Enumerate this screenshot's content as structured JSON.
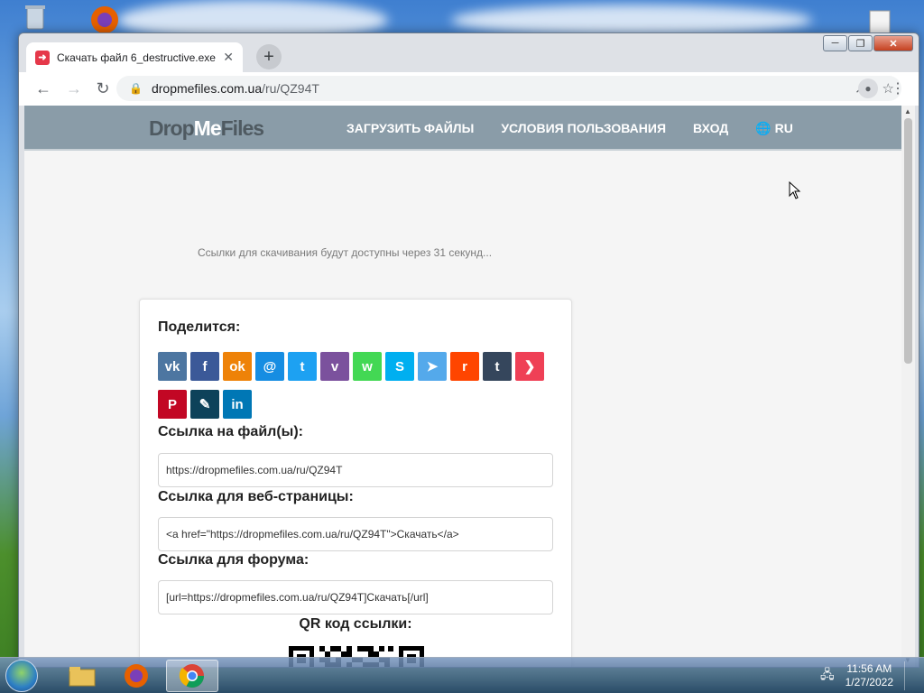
{
  "browser": {
    "tab_title": "Скачать файл 6_destructive.exe",
    "url_host": "dropmefiles.com.ua",
    "url_path": "/ru/QZ94T"
  },
  "site": {
    "logo_drop": "Drop",
    "logo_me": "Me",
    "logo_files": "Files",
    "nav": {
      "upload": "ЗАГРУЗИТЬ ФАЙЛЫ",
      "terms": "УСЛОВИЯ ПОЛЬЗОВАНИЯ",
      "login": "ВХОД",
      "lang": "RU"
    }
  },
  "page": {
    "countdown_text": "Ссылки для скачивания будут доступны через 31 секунд...",
    "share_heading": "Поделится:",
    "share_buttons": [
      {
        "name": "vk",
        "glyph": "vk",
        "color": "#4d76a1"
      },
      {
        "name": "facebook",
        "glyph": "f",
        "color": "#3b5998"
      },
      {
        "name": "odnoklassniki",
        "glyph": "ok",
        "color": "#ee8208"
      },
      {
        "name": "moimir",
        "glyph": "@",
        "color": "#168de2"
      },
      {
        "name": "twitter",
        "glyph": "t",
        "color": "#1da1f2"
      },
      {
        "name": "viber",
        "glyph": "v",
        "color": "#7b519d"
      },
      {
        "name": "whatsapp",
        "glyph": "w",
        "color": "#43d854"
      },
      {
        "name": "skype",
        "glyph": "S",
        "color": "#00aff0"
      },
      {
        "name": "telegram",
        "glyph": "➤",
        "color": "#54a9eb"
      },
      {
        "name": "reddit",
        "glyph": "r",
        "color": "#ff4500"
      },
      {
        "name": "tumblr",
        "glyph": "t",
        "color": "#35465c"
      },
      {
        "name": "pocket",
        "glyph": "❯",
        "color": "#ef4056"
      },
      {
        "name": "pinterest",
        "glyph": "P",
        "color": "#c20724"
      },
      {
        "name": "livejournal",
        "glyph": "✎",
        "color": "#0d425a"
      },
      {
        "name": "linkedin",
        "glyph": "in",
        "color": "#0077b5"
      }
    ],
    "file_link_label": "Ссылка на файл(ы):",
    "file_link_value": "https://dropmefiles.com.ua/ru/QZ94T",
    "web_link_label": "Ссылка для веб-страницы:",
    "web_link_value": "<a href=\"https://dropmefiles.com.ua/ru/QZ94T\">Скачать</a>",
    "forum_link_label": "Ссылка для форума:",
    "forum_link_value": "[url=https://dropmefiles.com.ua/ru/QZ94T]Скачать[/url]",
    "qr_label": "QR код ссылки:"
  },
  "taskbar": {
    "time": "11:56 AM",
    "date": "1/27/2022"
  }
}
